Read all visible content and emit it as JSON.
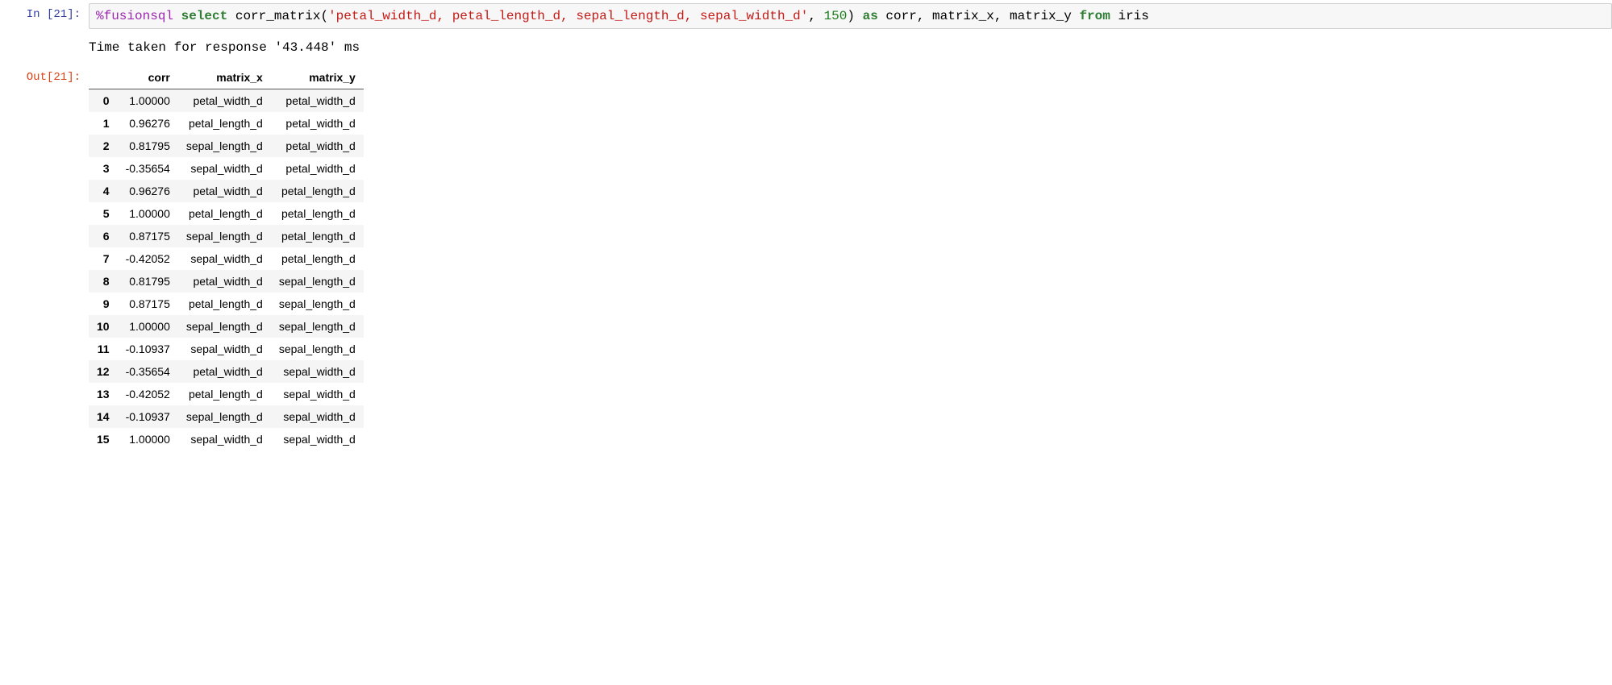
{
  "in_prompt": "In [21]:",
  "out_prompt": "Out[21]:",
  "code": {
    "magic": "%fusionsql",
    "sp1": " ",
    "select": "select",
    "sp2": " ",
    "func": "corr_matrix(",
    "arg_str": "'petal_width_d, petal_length_d, sepal_length_d, sepal_width_d'",
    "comma1": ", ",
    "arg_num": "150",
    "close": ")",
    "sp3": " ",
    "as": "as",
    "sp4": " ",
    "rest1": "corr, matrix_x, matrix_y ",
    "from": "from",
    "sp5": " ",
    "rest2": "iris"
  },
  "stdout_line": "Time taken for response '43.448' ms",
  "table": {
    "headers": [
      "corr",
      "matrix_x",
      "matrix_y"
    ],
    "rows": [
      {
        "idx": "0",
        "corr": "1.00000",
        "mx": "petal_width_d",
        "my": "petal_width_d"
      },
      {
        "idx": "1",
        "corr": "0.96276",
        "mx": "petal_length_d",
        "my": "petal_width_d"
      },
      {
        "idx": "2",
        "corr": "0.81795",
        "mx": "sepal_length_d",
        "my": "petal_width_d"
      },
      {
        "idx": "3",
        "corr": "-0.35654",
        "mx": "sepal_width_d",
        "my": "petal_width_d"
      },
      {
        "idx": "4",
        "corr": "0.96276",
        "mx": "petal_width_d",
        "my": "petal_length_d"
      },
      {
        "idx": "5",
        "corr": "1.00000",
        "mx": "petal_length_d",
        "my": "petal_length_d"
      },
      {
        "idx": "6",
        "corr": "0.87175",
        "mx": "sepal_length_d",
        "my": "petal_length_d"
      },
      {
        "idx": "7",
        "corr": "-0.42052",
        "mx": "sepal_width_d",
        "my": "petal_length_d"
      },
      {
        "idx": "8",
        "corr": "0.81795",
        "mx": "petal_width_d",
        "my": "sepal_length_d"
      },
      {
        "idx": "9",
        "corr": "0.87175",
        "mx": "petal_length_d",
        "my": "sepal_length_d"
      },
      {
        "idx": "10",
        "corr": "1.00000",
        "mx": "sepal_length_d",
        "my": "sepal_length_d"
      },
      {
        "idx": "11",
        "corr": "-0.10937",
        "mx": "sepal_width_d",
        "my": "sepal_length_d"
      },
      {
        "idx": "12",
        "corr": "-0.35654",
        "mx": "petal_width_d",
        "my": "sepal_width_d"
      },
      {
        "idx": "13",
        "corr": "-0.42052",
        "mx": "petal_length_d",
        "my": "sepal_width_d"
      },
      {
        "idx": "14",
        "corr": "-0.10937",
        "mx": "sepal_length_d",
        "my": "sepal_width_d"
      },
      {
        "idx": "15",
        "corr": "1.00000",
        "mx": "sepal_width_d",
        "my": "sepal_width_d"
      }
    ]
  }
}
